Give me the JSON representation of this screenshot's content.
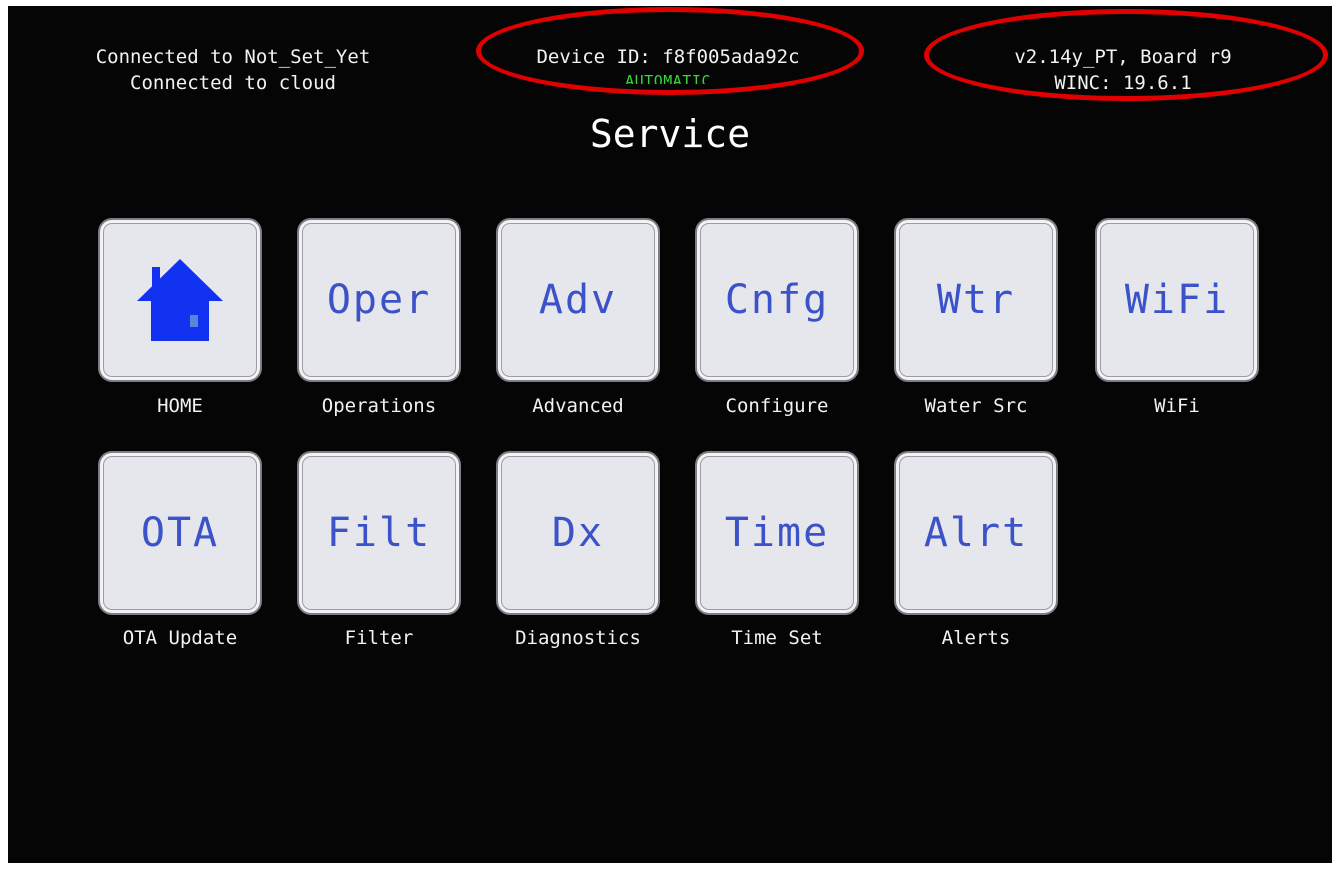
{
  "status": {
    "network_line": "Connected to Not_Set_Yet",
    "cloud_line": "Connected to cloud",
    "device_id": "Device ID: f8f005ada92c",
    "mode": "AUTOMATIC",
    "firmware": "v2.14y_PT, Board r9",
    "winc": "WINC: 19.6.1"
  },
  "screen_title": "Service",
  "annotation_color": "#e00000",
  "accent_color": "#3b52c8",
  "tiles": [
    {
      "abbr": "",
      "icon": "house-icon",
      "caption": "HOME"
    },
    {
      "abbr": "Oper",
      "caption": "Operations"
    },
    {
      "abbr": "Adv",
      "caption": "Advanced"
    },
    {
      "abbr": "Cnfg",
      "caption": "Configure"
    },
    {
      "abbr": "Wtr",
      "caption": "Water Src"
    },
    {
      "abbr": "WiFi",
      "caption": "WiFi"
    },
    {
      "abbr": "OTA",
      "caption": "OTA Update"
    },
    {
      "abbr": "Filt",
      "caption": "Filter"
    },
    {
      "abbr": "Dx",
      "caption": "Diagnostics"
    },
    {
      "abbr": "Time",
      "caption": "Time Set"
    },
    {
      "abbr": "Alrt",
      "caption": "Alerts"
    }
  ]
}
